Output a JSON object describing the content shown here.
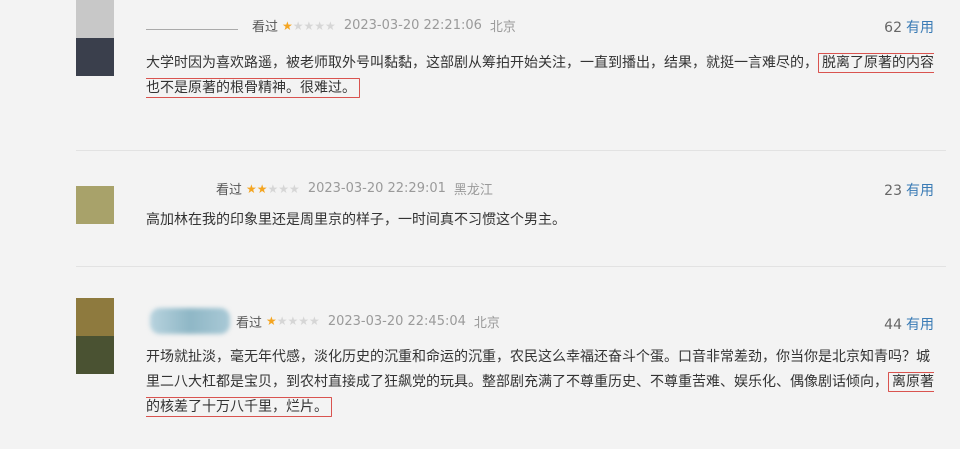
{
  "reviews": [
    {
      "status": "看过",
      "rating": 1,
      "time": "2023-03-20 22:21:06",
      "location": "北京",
      "votes": "62",
      "votes_label": "有用",
      "text_before": "大学时因为喜欢路遥，被老师取外号叫黏黏，这部剧从筹拍开始关注，一直到播出，结果，就挺一言难尽的，",
      "text_highlight": "脱离了原著的内容也不是原著的根骨精神。很难过。",
      "text_after": "",
      "avatar_colors": [
        "#c8c8c8",
        "#3a3f4c"
      ]
    },
    {
      "status": "看过",
      "rating": 2,
      "time": "2023-03-20 22:29:01",
      "location": "黑龙江",
      "votes": "23",
      "votes_label": "有用",
      "text_before": "高加林在我的印象里还是周里京的样子，一时间真不习惯这个男主。",
      "text_highlight": "",
      "text_after": "",
      "avatar_colors": [
        "#a8a26a"
      ]
    },
    {
      "status": "看过",
      "rating": 1,
      "time": "2023-03-20 22:45:04",
      "location": "北京",
      "votes": "44",
      "votes_label": "有用",
      "text_before": "开场就扯淡，毫无年代感，淡化历史的沉重和命运的沉重，农民这么幸福还奋斗个蛋。口音非常差劲，你当你是北京知青吗？城里二八大杠都是宝贝，到农村直接成了狂飙党的玩具。整部剧充满了不尊重历史、不尊重苦难、娱乐化、偶像剧话倾向，",
      "text_highlight": "离原著的核差了十万八千里，烂片。",
      "text_after": "",
      "avatar_colors": [
        "#8e7a3e",
        "#4a5232"
      ]
    }
  ]
}
